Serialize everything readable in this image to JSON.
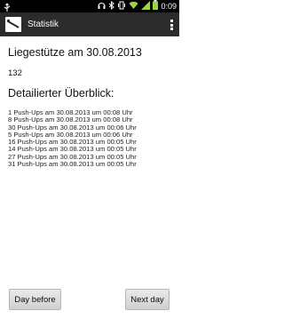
{
  "status_bar": {
    "time": "0:09",
    "icons": [
      "usb-notification-icon",
      "headset-icon",
      "bluetooth-icon",
      "vibrate-icon",
      "wifi-icon",
      "signal-icon",
      "battery-icon"
    ]
  },
  "action_bar": {
    "title": "Statistik",
    "icon": "app-logo-icon",
    "overflow_icon": "overflow-menu-icon"
  },
  "main": {
    "heading": "Liegestütze am 30.08.2013",
    "total": "132",
    "detail_heading": "Detailierter Überblick:",
    "entries": [
      "1 Push-Ups am 30.08.2013 um 00:08 Uhr",
      "8 Push-Ups am 30.08.2013 um 00:08 Uhr",
      "30 Push-Ups am 30.08.2013 um 00:06 Uhr",
      "5 Push-Ups am 30.08.2013 um 00:06 Uhr",
      "16 Push-Ups am 30.08.2013 um 00:05 Uhr",
      "14 Push-Ups am 30.08.2013 um 00:05 Uhr",
      "27 Push-Ups am 30.08.2013 um 00:05 Uhr",
      "31 Push-Ups am 30.08.2013 um 00:05 Uhr"
    ]
  },
  "buttons": {
    "previous": "Day before",
    "next": "Next day"
  },
  "colors": {
    "status_bar": "#000000",
    "action_bar": "#2b2b2b",
    "wifi_accent": "#9ed24b",
    "background": "#ffffff"
  }
}
